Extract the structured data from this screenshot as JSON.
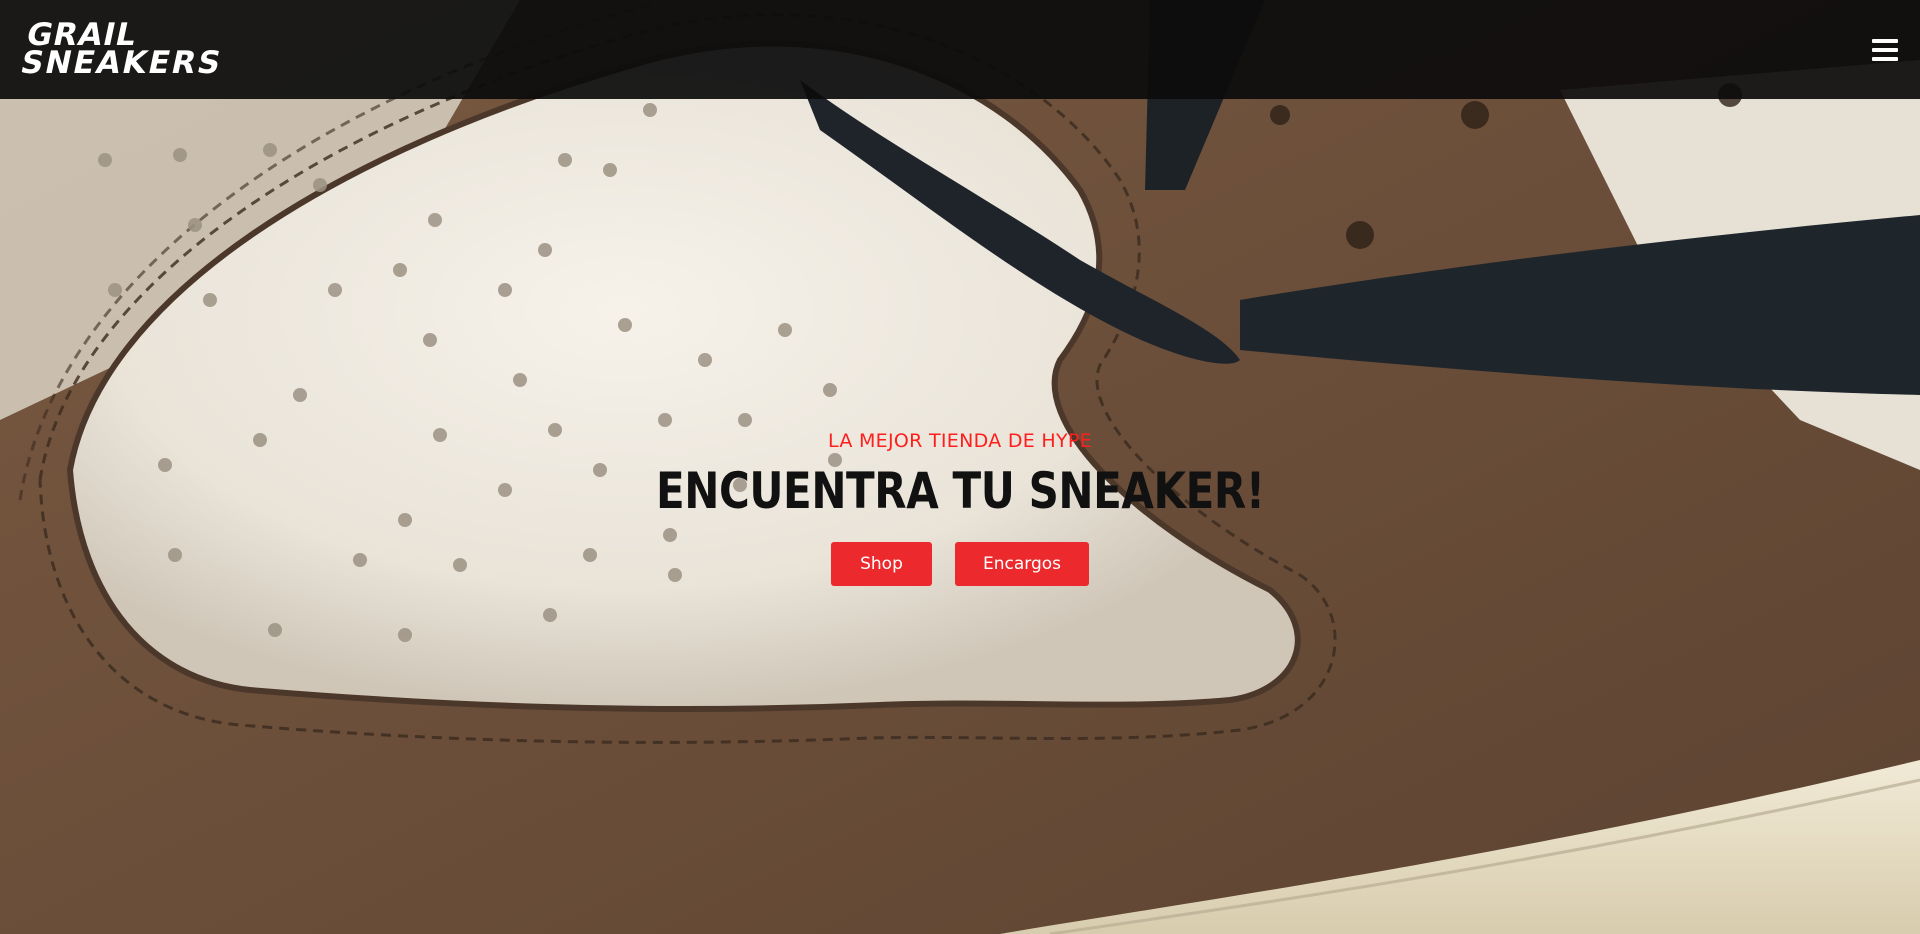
{
  "brand": {
    "logo_line1": "GRAIL",
    "logo_line2": "SNEAKERS"
  },
  "nav": {
    "menu_icon": "hamburger-menu-icon"
  },
  "hero": {
    "eyebrow": "LA MEJOR TIENDA DE HYPE",
    "headline": "ENCUENTRA TU SNEAKER!",
    "buttons": [
      {
        "label": "Shop"
      },
      {
        "label": "Encargos"
      }
    ],
    "background_image": "sneaker-closeup"
  },
  "colors": {
    "accent": "#ec2a2e",
    "eyebrow": "#ff1e1e",
    "navbar": "#0c0c0c",
    "headline": "#111111"
  }
}
